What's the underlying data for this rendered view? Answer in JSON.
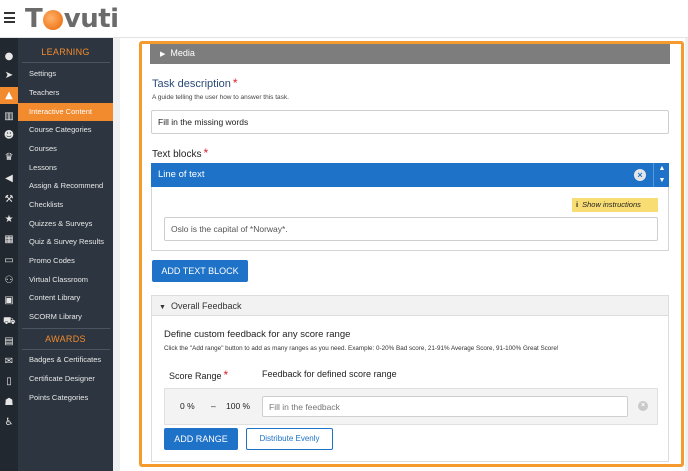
{
  "header": {
    "logo_text_first": "T",
    "logo_text_rest": "vuti"
  },
  "rail": {
    "icons": [
      "home-icon",
      "rocket-icon",
      "graduation-cap-icon",
      "chart-icon",
      "users-icon",
      "trophy-icon",
      "megaphone-icon",
      "gavel-icon",
      "star-icon",
      "table-icon",
      "card-icon",
      "sitemap-icon",
      "address-book-icon",
      "cart-icon",
      "calendar-icon",
      "comments-icon",
      "file-icon",
      "contact-icon",
      "accessibility-icon"
    ]
  },
  "sidebar": {
    "learning_heading": "LEARNING",
    "awards_heading": "AWARDS",
    "learning_items": [
      "Settings",
      "Teachers",
      "Interactive Content",
      "Course Categories",
      "Courses",
      "Lessons",
      "Assign & Recommend",
      "Checklists",
      "Quizzes & Surveys",
      "Quiz & Survey Results",
      "Promo Codes",
      "Virtual Classroom",
      "Content Library",
      "SCORM Library"
    ],
    "active_item": "Interactive Content",
    "awards_items": [
      "Badges & Certificates",
      "Certificate Designer",
      "Points Categories"
    ]
  },
  "editor": {
    "media_label": "Media",
    "task_description_label": "Task description",
    "required_mark": "*",
    "task_description_hint": "A guide telling the user how to answer this task.",
    "task_description_value": "Fill in the missing words",
    "text_blocks_label": "Text blocks",
    "line_of_text_label": "Line of text",
    "show_instructions_label": "Show instructions",
    "line_of_text_value": "Oslo is the capital of *Norway*.",
    "add_text_block_label": "ADD TEXT BLOCK",
    "overall_feedback_label": "Overall Feedback",
    "feedback_intro": "Define custom feedback for any score range",
    "feedback_hint": "Click the \"Add range\" button to add as many ranges as you need. Example: 0-20% Bad score, 21-91% Average Score, 91-100% Great Score!",
    "score_range_label": "Score Range",
    "feedback_col_label": "Feedback for defined score range",
    "range_from": "0 %",
    "range_dash": "–",
    "range_to": "100 %",
    "feedback_placeholder": "Fill in the feedback",
    "add_range_label": "ADD RANGE",
    "distribute_label": "Distribute Evenly"
  },
  "colors": {
    "accent": "#f28a2e",
    "primary": "#1e72c8",
    "sidebar_bg": "#2d3640",
    "highlight_border": "#f59a2c"
  }
}
